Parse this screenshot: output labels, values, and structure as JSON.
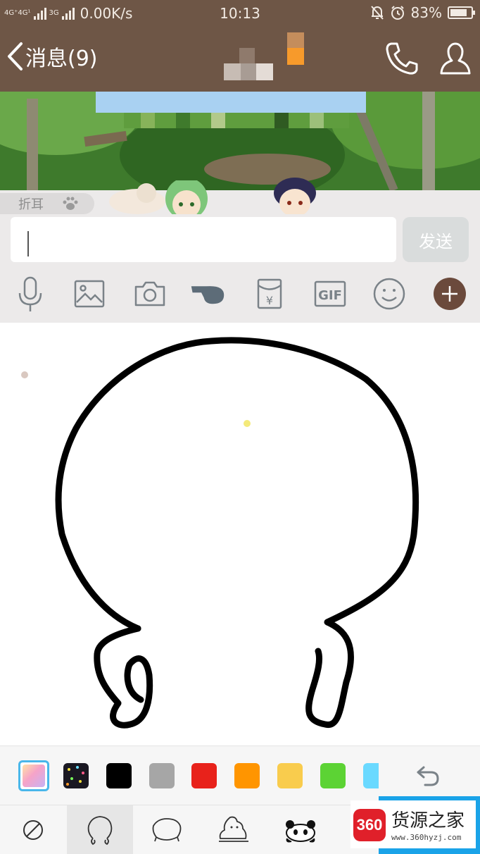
{
  "status_bar": {
    "network_label": "4G⁺4G¹",
    "network_label_2": "3G",
    "speed": "0.00K/s",
    "time": "10:13",
    "battery": "83%",
    "battery_level": 0.83
  },
  "nav": {
    "back_label": "消息(9)"
  },
  "collapse": {
    "label": "折耳"
  },
  "input": {
    "value": "",
    "send_label": "发送"
  },
  "toolbar_icons": [
    "microphone-icon",
    "image-icon",
    "camera-icon",
    "poke-icon",
    "red-packet-icon",
    "gif-icon",
    "emoji-icon",
    "plus-icon"
  ],
  "toolbar": {
    "gif_label": "GIF",
    "red_packet_symbol": "¥"
  },
  "palette": {
    "colors": [
      "#ffffff",
      "#000000",
      "#a6a6a6",
      "#e8221b",
      "#ff9500",
      "#f9cc4d",
      "#5cd334",
      "#6ad9ff"
    ],
    "selected": "gradient"
  },
  "shape_icons": [
    "none-icon",
    "round-head-outline-icon",
    "oval-head-outline-icon",
    "sitting-figure-icon",
    "panda-icon"
  ],
  "shape_selected_index": 1,
  "watermark": {
    "logo": "360",
    "title": "货源之家",
    "url": "www.360hyzj.com"
  }
}
